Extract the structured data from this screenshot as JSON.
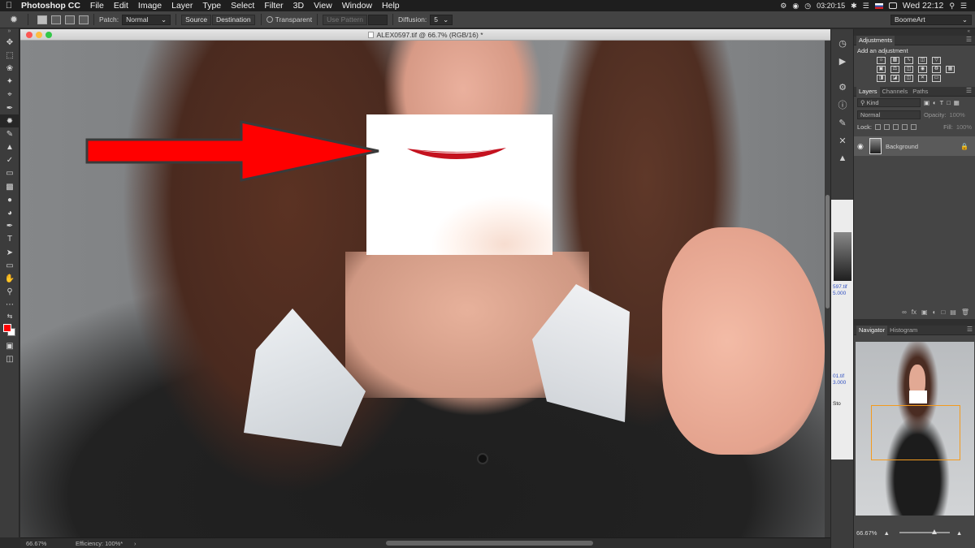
{
  "menubar": {
    "app_name": "Photoshop CC",
    "menus": [
      "File",
      "Edit",
      "Image",
      "Layer",
      "Type",
      "Select",
      "Filter",
      "3D",
      "View",
      "Window",
      "Help"
    ],
    "clock_small": "03:20:15",
    "datetime": "Wed 22:12"
  },
  "options": {
    "patch_label": "Patch:",
    "patch_mode": "Normal",
    "source_label": "Source",
    "destination_label": "Destination",
    "transparent_label": "Transparent",
    "use_pattern_label": "Use Pattern",
    "diffusion_label": "Diffusion:",
    "diffusion_value": "5",
    "workspace": "BoomeArt"
  },
  "document": {
    "title": "ALEX0597.tif @ 66.7% (RGB/16) *",
    "zoom": "66.67%",
    "efficiency": "Efficiency: 100%*"
  },
  "dock": {
    "mini1_text": "597.tif",
    "mini1_sub": "5.000",
    "mini2_text": "01.tif",
    "mini2_sub": "3.000",
    "mini3_text": "Sto"
  },
  "adjustments": {
    "tab": "Adjustments",
    "subtitle": "Add an adjustment"
  },
  "layers": {
    "tabs": [
      "Layers",
      "Channels",
      "Paths"
    ],
    "kind_label": "Kind",
    "blend_mode": "Normal",
    "opacity_label": "Opacity:",
    "opacity_value": "100%",
    "lock_label": "Lock:",
    "fill_label": "Fill:",
    "fill_value": "100%",
    "layer_name": "Background"
  },
  "navigator": {
    "tabs": [
      "Navigator",
      "Histogram"
    ],
    "zoom": "66.67%"
  },
  "colors": {
    "foreground": "#ff0000",
    "background": "#ffffff",
    "navigator_proxy": "#f39a1e"
  }
}
